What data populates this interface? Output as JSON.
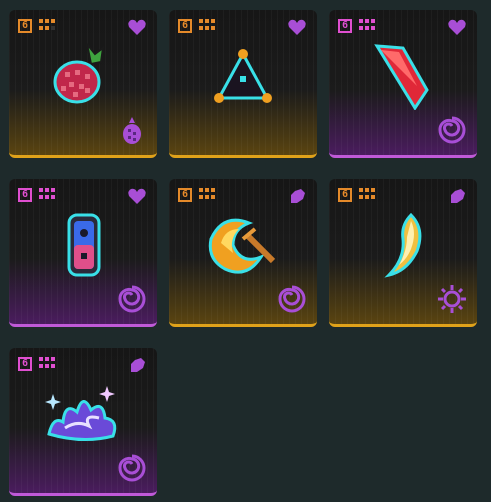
{
  "colors": {
    "background": "#1e2a2b",
    "gold_accent": "#e0a21a",
    "purple_accent": "#c05ad8",
    "heart": "#a84ed6",
    "tier_gold": "#e58a2a",
    "tier_purple": "#e04fd0"
  },
  "inventory": {
    "cards": [
      {
        "rarity": "gold",
        "tier": "6",
        "item_icon": "pineapple-icon",
        "corner_icon": "heart-icon",
        "bottom_icon": "pineapple-small-icon"
      },
      {
        "rarity": "gold",
        "tier": "6",
        "item_icon": "triangle-pyramid-icon",
        "corner_icon": "heart-icon",
        "bottom_icon": "none"
      },
      {
        "rarity": "purple",
        "tier": "6",
        "item_icon": "red-crystal-shard-icon",
        "corner_icon": "heart-icon",
        "bottom_icon": "swirl-icon"
      },
      {
        "rarity": "purple",
        "tier": "6",
        "item_icon": "game-controller-icon",
        "corner_icon": "heart-icon",
        "bottom_icon": "swirl-icon"
      },
      {
        "rarity": "gold",
        "tier": "6",
        "item_icon": "fire-sword-icon",
        "corner_icon": "hand-icon",
        "bottom_icon": "swirl-icon"
      },
      {
        "rarity": "gold",
        "tier": "6",
        "item_icon": "golden-fang-icon",
        "corner_icon": "hand-icon",
        "bottom_icon": "sun-gear-icon"
      },
      {
        "rarity": "purple",
        "tier": "6",
        "item_icon": "purple-crystal-burst-icon",
        "corner_icon": "hand-icon",
        "bottom_icon": "swirl-icon"
      }
    ]
  }
}
